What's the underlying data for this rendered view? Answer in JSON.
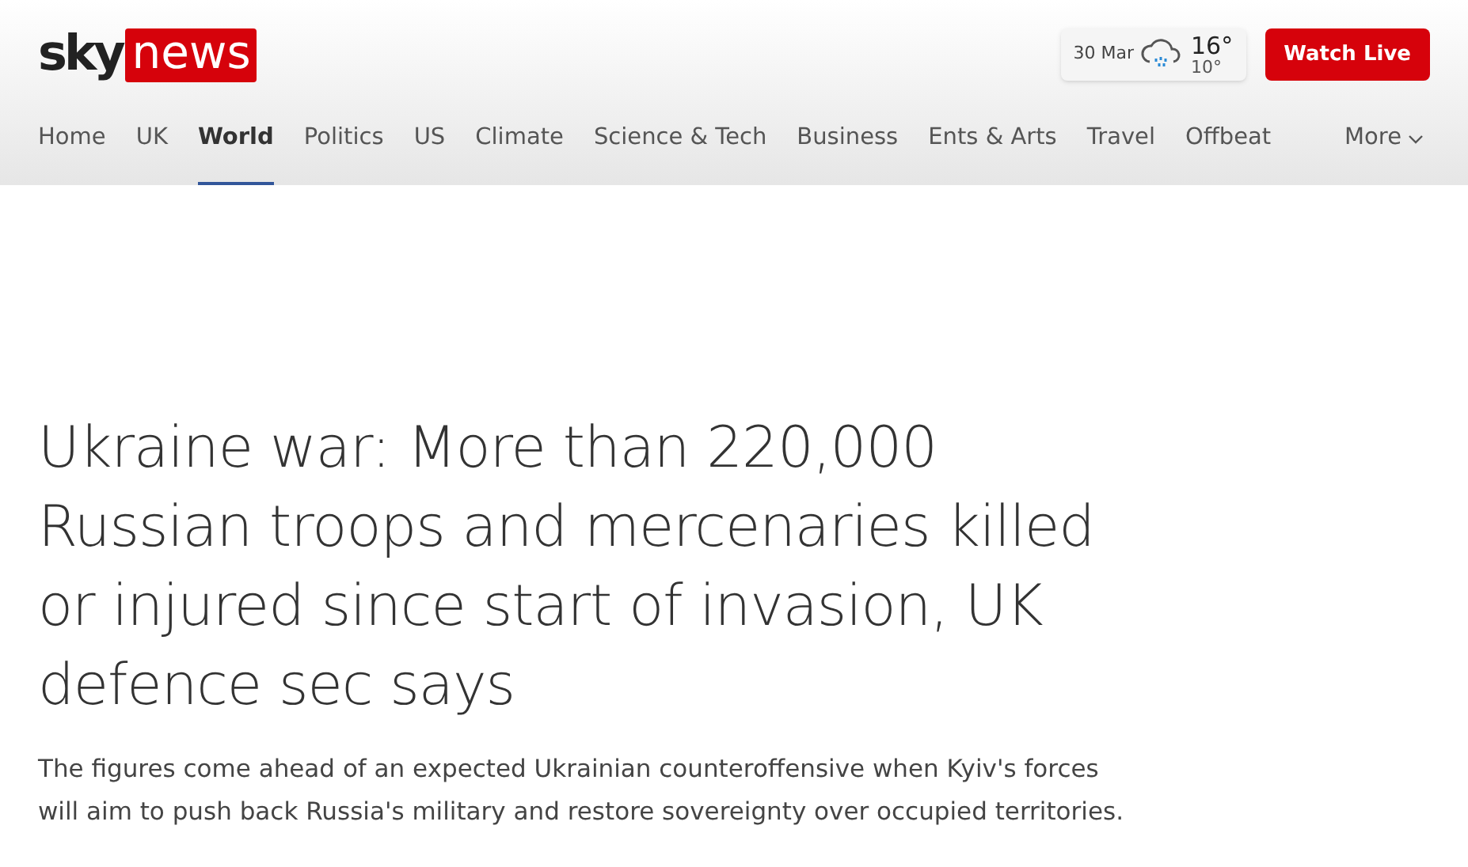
{
  "logo": {
    "sky": "sky",
    "news": "news"
  },
  "weather": {
    "date": "30 Mar",
    "high": "16°",
    "low": "10°"
  },
  "watch_live": "Watch Live",
  "nav": [
    {
      "label": "Home",
      "selected": false
    },
    {
      "label": "UK",
      "selected": false
    },
    {
      "label": "World",
      "selected": true
    },
    {
      "label": "Politics",
      "selected": false
    },
    {
      "label": "US",
      "selected": false
    },
    {
      "label": "Climate",
      "selected": false
    },
    {
      "label": "Science & Tech",
      "selected": false
    },
    {
      "label": "Business",
      "selected": false
    },
    {
      "label": "Ents & Arts",
      "selected": false
    },
    {
      "label": "Travel",
      "selected": false
    },
    {
      "label": "Offbeat",
      "selected": false
    }
  ],
  "more": "More",
  "article": {
    "headline": "Ukraine war: More than 220,000 Russian troops and mercenaries killed or injured since start of invasion, UK defence sec says",
    "summary": "The figures come ahead of an expected Ukrainian counteroffensive when Kyiv's forces will aim to push back Russia's military and restore sovereignty over occupied territories."
  }
}
